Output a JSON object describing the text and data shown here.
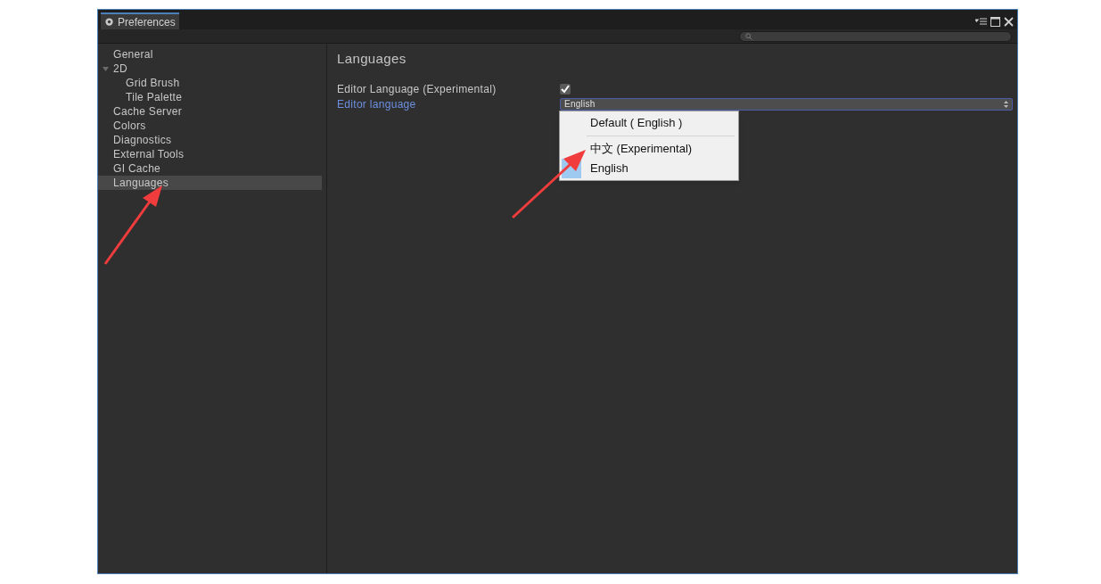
{
  "window": {
    "title": "Preferences"
  },
  "sidebar": {
    "items": [
      {
        "label": "General",
        "selected": false
      },
      {
        "label": "2D",
        "selected": false,
        "expanded": true,
        "children": [
          {
            "label": "Grid Brush",
            "selected": false
          },
          {
            "label": "Tile Palette",
            "selected": false
          }
        ]
      },
      {
        "label": "Cache Server",
        "selected": false
      },
      {
        "label": "Colors",
        "selected": false
      },
      {
        "label": "Diagnostics",
        "selected": false
      },
      {
        "label": "External Tools",
        "selected": false
      },
      {
        "label": "GI Cache",
        "selected": false
      },
      {
        "label": "Languages",
        "selected": true
      }
    ]
  },
  "content": {
    "heading": "Languages",
    "editor_language_toggle": {
      "label": "Editor Language (Experimental)",
      "checked": true
    },
    "editor_language_select": {
      "label": "Editor language",
      "value": "English"
    },
    "dropdown_menu": {
      "items": [
        {
          "label": "Default ( English )",
          "selected": false
        },
        {
          "label": "中文 (Experimental)",
          "selected": false,
          "separator_before": true
        },
        {
          "label": "English",
          "selected": true
        }
      ]
    }
  }
}
